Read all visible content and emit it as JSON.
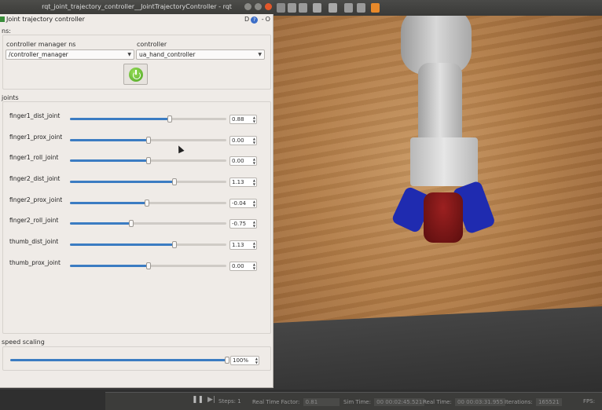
{
  "window": {
    "title": "rqt_joint_trajectory_controller__JointTrajectoryController - rqt"
  },
  "plugin": {
    "title": "Joint trajectory controller",
    "buttons": [
      "D",
      "?",
      "-",
      "O"
    ]
  },
  "ns_section": {
    "label": "ns:",
    "controller_manager_label": "controller manager ns",
    "controller_manager_value": "/controller_manager",
    "controller_label": "controller",
    "controller_value": "ua_hand_controller"
  },
  "joints_section": {
    "label": "joints",
    "joints": [
      {
        "name": "finger1_dist_joint",
        "value": "0.88",
        "fraction": 0.64
      },
      {
        "name": "finger1_prox_joint",
        "value": "0.00",
        "fraction": 0.5
      },
      {
        "name": "finger1_roll_joint",
        "value": "0.00",
        "fraction": 0.5
      },
      {
        "name": "finger2_dist_joint",
        "value": "1.13",
        "fraction": 0.67
      },
      {
        "name": "finger2_prox_joint",
        "value": "-0.04",
        "fraction": 0.49
      },
      {
        "name": "finger2_roll_joint",
        "value": "-0.75",
        "fraction": 0.39
      },
      {
        "name": "thumb_dist_joint",
        "value": "1.13",
        "fraction": 0.67
      },
      {
        "name": "thumb_prox_joint",
        "value": "0.00",
        "fraction": 0.5
      }
    ]
  },
  "speed_section": {
    "label": "speed scaling",
    "value": "100%",
    "fraction": 1.0
  },
  "gazebo_status": {
    "steps_label": "Steps:",
    "steps_value": "1",
    "rtf_label": "Real Time Factor:",
    "rtf_value": "0.81",
    "sim_time_label": "Sim Time:",
    "sim_time_value": "00 00:02:45.521",
    "real_time_label": "Real Time:",
    "real_time_value": "00 00:03:31.955",
    "iterations_label": "Iterations:",
    "iterations_value": "165521",
    "fps_label": "FPS:"
  }
}
